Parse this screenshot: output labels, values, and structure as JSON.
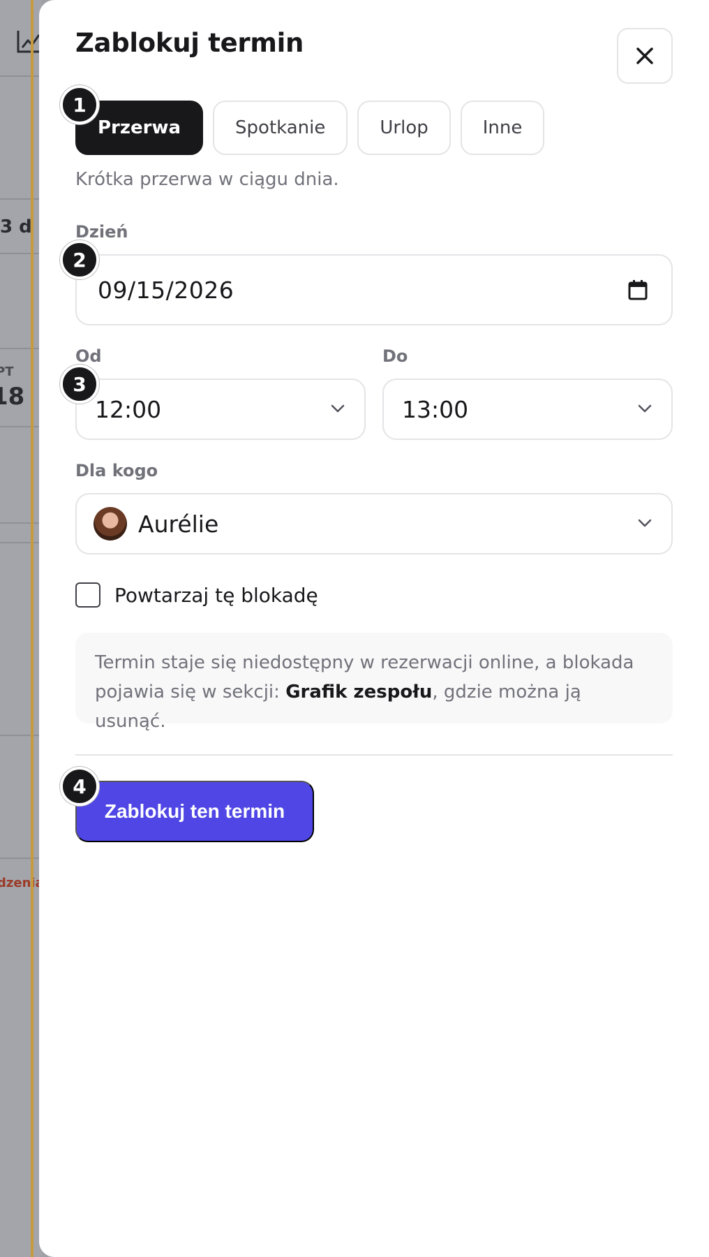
{
  "background": {
    "count_text": "3 d",
    "weekday": "PT",
    "day_number": "18",
    "note_text": "dzenia"
  },
  "panel": {
    "title": "Zablokuj termin",
    "close_icon": "close-icon",
    "tabs": [
      {
        "label": "Przerwa",
        "active": true
      },
      {
        "label": "Spotkanie",
        "active": false
      },
      {
        "label": "Urlop",
        "active": false
      },
      {
        "label": "Inne",
        "active": false
      }
    ],
    "description": "Krótka przerwa w ciągu dnia.",
    "day": {
      "label": "Dzień",
      "value": "09/15/2026",
      "icon": "calendar-icon"
    },
    "from": {
      "label": "Od",
      "value": "12:00"
    },
    "to": {
      "label": "Do",
      "value": "13:00"
    },
    "for_whom": {
      "label": "Dla kogo",
      "value": "Aurélie"
    },
    "repeat": {
      "label": "Powtarzaj tę blokadę",
      "checked": false
    },
    "info": {
      "text_before": "Termin staje się niedostępny w rezerwacji online, a blokada pojawia się w sekcji: ",
      "bold": "Grafik zespołu",
      "text_after": ", gdzie można ją usunąć."
    },
    "submit_label": "Zablokuj ten termin",
    "badges": [
      "1",
      "2",
      "3",
      "4"
    ]
  },
  "colors": {
    "accent": "#4f46e5",
    "active_tab": "#18181b",
    "text": "#18181b",
    "muted": "#71717a"
  }
}
